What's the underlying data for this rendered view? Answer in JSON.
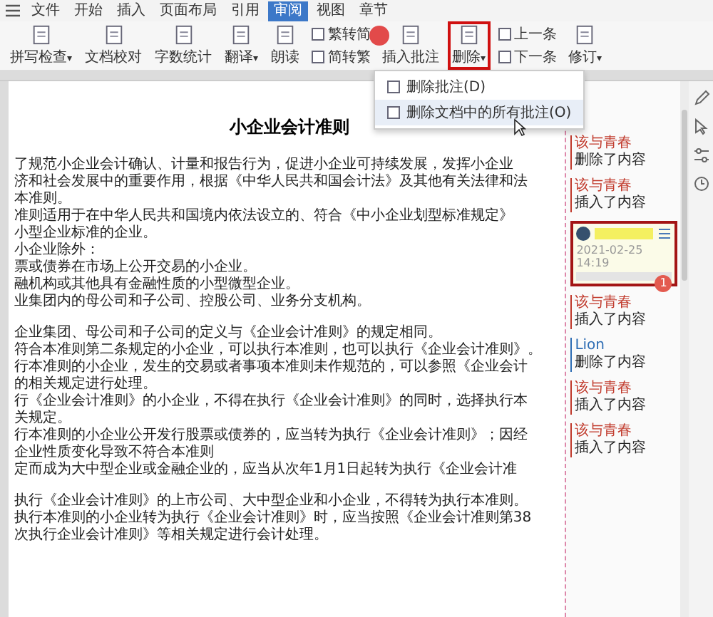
{
  "menu_bar": {
    "file": "文件",
    "tabs": [
      {
        "label": "开始",
        "selected": false
      },
      {
        "label": "插入",
        "selected": false
      },
      {
        "label": "页面布局",
        "selected": false
      },
      {
        "label": "引用",
        "selected": false
      },
      {
        "label": "审阅",
        "selected": true
      },
      {
        "label": "视图",
        "selected": false
      },
      {
        "label": "章节",
        "selected": false
      }
    ]
  },
  "ribbon": [
    {
      "kind": "large",
      "label": "拼写检查",
      "caret": "▾",
      "highlighted": false
    },
    {
      "kind": "large",
      "label": "文档校对",
      "highlighted": false
    },
    {
      "kind": "large",
      "label": "字数统计",
      "highlighted": false
    },
    {
      "kind": "large",
      "label": "翻译",
      "caret": "▾",
      "highlighted": false
    },
    {
      "kind": "large",
      "label": "朗读",
      "highlighted": false
    },
    {
      "kind": "pair",
      "items": [
        "繁转简",
        "简转繁"
      ]
    },
    {
      "kind": "large",
      "label": "插入批注",
      "highlighted": false,
      "step_dot": true
    },
    {
      "kind": "large",
      "label": "删除",
      "caret": "▾",
      "highlighted": true
    },
    {
      "kind": "pair",
      "items": [
        "上一条",
        "下一条"
      ]
    },
    {
      "kind": "large",
      "label": "修订",
      "caret": "▾",
      "highlighted": false
    }
  ],
  "delete_menu": {
    "items": [
      "删除批注(D)",
      "删除文档中的所有批注(O)"
    ]
  },
  "document": {
    "title": "小企业会计准则",
    "blocks": [
      [
        "了规范小企业会计确认、计量和报告行为，促进小企业可持续发展，发挥小企业",
        "济和社会发展中的重要作用，根据《中华人民共和国会计法》及其他有关法律和法",
        "本准则。",
        "准则适用于在中华人民共和国境内依法设立的、符合《中小企业划型标准规定》",
        "小型企业标准的企业。",
        "小企业除外：",
        "票或债券在市场上公开交易的小企业。",
        "融机构或其他具有金融性质的小型微型企业。",
        "业集团内的母公司和子公司、控股公司、业务分支机构。"
      ],
      [
        "企业集团、母公司和子公司的定义与《企业会计准则》的规定相同。",
        "符合本准则第二条规定的小企业，可以执行本准则，也可以执行《企业会计准则》。",
        "行本准则的小企业，发生的交易或者事项本准则未作规范的，可以参照《企业会计",
        "的相关规定进行处理。",
        "行《企业会计准则》的小企业，不得在执行《企业会计准则》的同时，选择执行本",
        "关规定。",
        "行本准则的小企业公开发行股票或债券的，应当转为执行《企业会计准则》；因经",
        "企业性质变化导致不符合本准则",
        "定而成为大中型企业或金融企业的，应当从次年1月1日起转为执行《企业会计准"
      ],
      [
        "执行《企业会计准则》的上市公司、大中型企业和小企业，不得转为执行本准则。",
        "执行本准则的小企业转为执行《企业会计准则》时，应当按照《企业会计准则第38",
        "次执行企业会计准则》等相关规定进行会计处理。"
      ]
    ]
  },
  "revisions": [
    {
      "kind": "change",
      "author": "该与青春",
      "action": "删除了内容",
      "color": "#c0392b"
    },
    {
      "kind": "change",
      "author": "该与青春",
      "action": "插入了内容",
      "color": "#c0392b"
    },
    {
      "kind": "comment",
      "date": "2021-02-25 14:19",
      "badge": "1",
      "highlighted": true
    },
    {
      "kind": "change",
      "author": "该与青春",
      "action": "插入了内容",
      "color": "#c0392b"
    },
    {
      "kind": "change",
      "author": "Lion",
      "action": "删除了内容",
      "color": "#2e6db4"
    },
    {
      "kind": "change",
      "author": "该与青春",
      "action": "插入了内容",
      "color": "#c0392b"
    },
    {
      "kind": "change",
      "author": "该与青春",
      "action": "插入了内容",
      "color": "#c0392b"
    }
  ]
}
